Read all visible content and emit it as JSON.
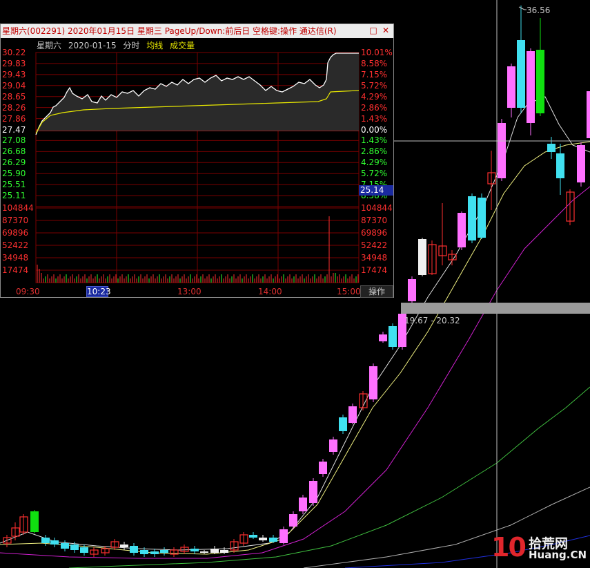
{
  "main_chart": {
    "peak_label": "36.56",
    "range_label": "19.67 - 20.32",
    "colors": {
      "up": "#ff70ff",
      "down": "#40e0f0",
      "green": "#10e010",
      "ma_yellow": "#f0f080",
      "ma_white": "#e0e0e0",
      "ma_magenta": "#d020d0",
      "ma_green": "#40c040",
      "ma_gray": "#b0b0b0",
      "ma_blue": "#2030e0",
      "crosshair": "#c0c0c0"
    }
  },
  "popup": {
    "title": "星期六(002291) 2020年01月15日 星期三 PageUp/Down:前后日 空格键:操作 通达信(R)",
    "restore_icon": "□",
    "close_icon": "✕",
    "sub_day": "星期六",
    "sub_date": "2020-01-15",
    "sub_mode": "分时",
    "sub_avg": "均线",
    "sub_vol": "成交量",
    "price_labels": [
      "30.22",
      "29.83",
      "29.43",
      "29.04",
      "28.65",
      "28.26",
      "27.86",
      "27.47",
      "27.08",
      "26.68",
      "26.29",
      "25.90",
      "25.51",
      "25.11"
    ],
    "pct_labels": [
      "10.01%",
      "8.58%",
      "7.15%",
      "5.72%",
      "4.29%",
      "2.86%",
      "1.43%",
      "0.00%",
      "1.43%",
      "2.86%",
      "4.29%",
      "5.72%",
      "7.15%",
      "8.58%"
    ],
    "volume_labels": [
      "104844",
      "87370",
      "69896",
      "52422",
      "34948",
      "17474"
    ],
    "time_labels": [
      "09:30",
      "13:00",
      "14:00",
      "15:00"
    ],
    "cursor_time": "10:23",
    "current_price": "25.14",
    "operate_button": "操作",
    "colors": {
      "up": "#ff3030",
      "down": "#30ff30",
      "flat": "#ffffff",
      "price_line": "#ffffff",
      "avg_line": "#e8e800"
    }
  }
}
